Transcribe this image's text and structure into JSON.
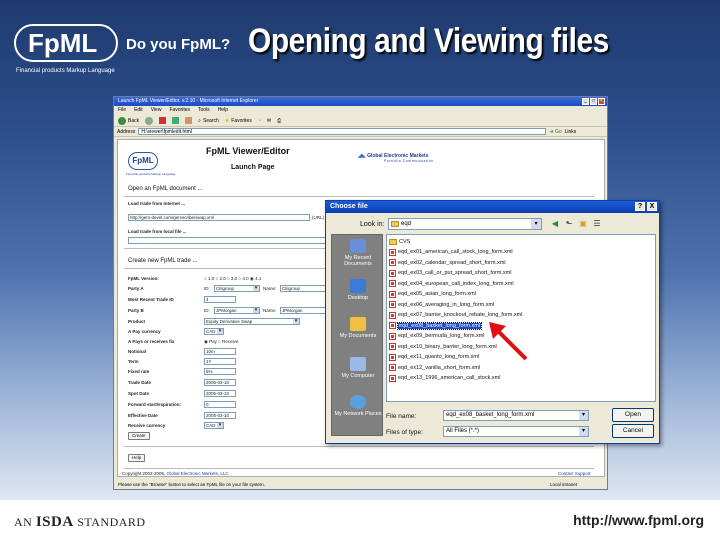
{
  "slide": {
    "logo": "FpML",
    "logo_sub": "Financial products Markup Language",
    "tagline": "Do you FpML?",
    "title": "Opening and Viewing files",
    "footer_left_a": "AN",
    "footer_left_b": "ISDA",
    "footer_left_c": "STANDARD",
    "footer_url": "http://www.fpml.org"
  },
  "browser": {
    "title": "Launch FpML Viewer/Editor, v.2.10 - Microsoft Internet Explorer",
    "menu": [
      "File",
      "Edit",
      "View",
      "Favorites",
      "Tools",
      "Help"
    ],
    "toolbar": {
      "back": "Back",
      "search": "Search",
      "favorites": "Favorites"
    },
    "address_label": "Address",
    "address_value": "H:\\viewer\\fpmledit.html",
    "go": "Go",
    "links": "Links",
    "status_left": "Please use the \"Browse\" button to select an FpML file on your file system.",
    "status_right": "Local intranet"
  },
  "page": {
    "logo": "FpML",
    "logo_sub": "Financial products Markup Language",
    "title": "FpML Viewer/Editor",
    "subtitle": "Launch Page",
    "gem_name": "Global Electronic Markets",
    "gem_sub": "Portfolio Communication",
    "open_heading": "Open an FpML document ...",
    "load_internet": "Load trade from Internet ...",
    "internet_url": "http://gem-devel.com/gemscribe/swap.xml",
    "url_label": "(URL)",
    "load_local": "Load trade from local file ...",
    "new_heading": "Create new FpML trade ...",
    "fields": [
      {
        "label": "FpML Version:",
        "value": "○ 1.0  ○ 2.0  ○ 3.0  ○ 4.0  ◉ 4.1"
      },
      {
        "label": "Party A",
        "id": "Citigroup",
        "name": "Citigroup"
      },
      {
        "label": "Most Recent Trade ID",
        "value": "4"
      },
      {
        "label": "Party B",
        "id": "JPMorgan",
        "name": "JPMorgan"
      },
      {
        "label": "Product",
        "value": "Equity Derivative Swap"
      },
      {
        "label": "A Pay currency",
        "value": "CAD"
      },
      {
        "label": "A Pays or receives fix",
        "value": "◉ Pay  ○ Receive"
      },
      {
        "label": "Notional",
        "value": "10m"
      },
      {
        "label": "Term",
        "value": "1Y"
      },
      {
        "label": "Fixed rate",
        "value": "5%"
      },
      {
        "label": "Trade Date",
        "value": "2005-03-10"
      },
      {
        "label": "Spot Date",
        "value": "2005-03-10"
      },
      {
        "label": "Forward start/expiration:",
        "value": "0"
      },
      {
        "label": "Effective Date",
        "value": "2005-03-10"
      },
      {
        "label": "Receive currency",
        "value": "CAD"
      }
    ],
    "id_label": "ID:",
    "name_label": "Name:",
    "create_button": "Create",
    "help_button": "Help",
    "copyright": "Copyright 2002-2005,",
    "copyright_link": "Global Electronic Markets, LLC",
    "contact_link": "Contact Support"
  },
  "dialog": {
    "title": "Choose file",
    "help": "?",
    "close": "X",
    "look_in_label": "Look in:",
    "look_in_value": "eqd",
    "places": [
      "My Recent Documents",
      "Desktop",
      "My Documents",
      "My Computer",
      "My Network Places"
    ],
    "files": [
      {
        "name": "CVS",
        "type": "folder"
      },
      {
        "name": "eqd_ex01_american_call_stock_long_form.xml",
        "type": "xml"
      },
      {
        "name": "eqd_ex02_calendar_spread_short_form.xml",
        "type": "xml"
      },
      {
        "name": "eqd_ex03_call_or_put_spread_short_form.xml",
        "type": "xml"
      },
      {
        "name": "eqd_ex04_european_call_index_long_form.xml",
        "type": "xml"
      },
      {
        "name": "eqd_ex05_asian_long_form.xml",
        "type": "xml"
      },
      {
        "name": "eqd_ex06_averaging_in_long_form.xml",
        "type": "xml"
      },
      {
        "name": "eqd_ex07_barrier_knockout_rebate_long_form.xml",
        "type": "xml"
      },
      {
        "name": "eqd_ex08_basket_long_form.xml",
        "type": "xml",
        "selected": true
      },
      {
        "name": "eqd_ex09_bermuda_long_form.xml",
        "type": "xml"
      },
      {
        "name": "eqd_ex10_binary_barrier_long_form.xml",
        "type": "xml"
      },
      {
        "name": "eqd_ex11_quanto_long_form.xml",
        "type": "xml"
      },
      {
        "name": "eqd_ex12_vanilla_short_form.xml",
        "type": "xml"
      },
      {
        "name": "eqd_ex13_1996_american_call_stock.xml",
        "type": "xml"
      }
    ],
    "file_name_label": "File name:",
    "file_name_value": "eqd_ex08_basket_long_form.xml",
    "file_type_label": "Files of type:",
    "file_type_value": "All Files (*.*)",
    "open_button": "Open",
    "cancel_button": "Cancel"
  },
  "colors": {
    "accent_arrow": "#e01010",
    "selection": "#1c4bc2"
  }
}
